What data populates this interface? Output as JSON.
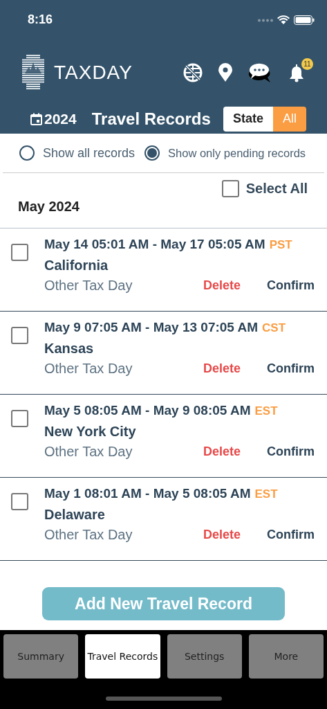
{
  "status_bar": {
    "time": "8:16"
  },
  "header": {
    "app_name": "TAXDAY",
    "notification_count": "11",
    "year": "2024",
    "title": "Travel Records",
    "scope_toggle": [
      {
        "label": "State",
        "selected": false
      },
      {
        "label": "All",
        "selected": true
      }
    ]
  },
  "filters": [
    {
      "label": "Show all records",
      "selected": false
    },
    {
      "label": "Show only pending records",
      "selected": true
    }
  ],
  "select_all": {
    "label": "Select All",
    "checked": false
  },
  "month": "May 2024",
  "records": [
    {
      "range": "May 14 05:01 AM - May 17 05:05 AM",
      "zone": "PST",
      "place": "California",
      "type": "Other Tax Day",
      "checked": false,
      "delete": "Delete",
      "confirm": "Confirm"
    },
    {
      "range": "May 9 07:05 AM - May 13 07:05 AM",
      "zone": "CST",
      "place": "Kansas",
      "type": "Other Tax Day",
      "checked": false,
      "delete": "Delete",
      "confirm": "Confirm"
    },
    {
      "range": "May 5 08:05 AM - May 9 08:05 AM",
      "zone": "EST",
      "place": "New York City",
      "type": "Other Tax Day",
      "checked": false,
      "delete": "Delete",
      "confirm": "Confirm"
    },
    {
      "range": "May 1 08:01 AM - May 5 08:05 AM",
      "zone": "EST",
      "place": "Delaware",
      "type": "Other Tax Day",
      "checked": false,
      "delete": "Delete",
      "confirm": "Confirm"
    }
  ],
  "add_button": "Add New Travel Record",
  "tabs": [
    {
      "label": "Summary",
      "selected": false
    },
    {
      "label": "Travel Records",
      "selected": true
    },
    {
      "label": "Settings",
      "selected": false
    },
    {
      "label": "More",
      "selected": false
    }
  ]
}
